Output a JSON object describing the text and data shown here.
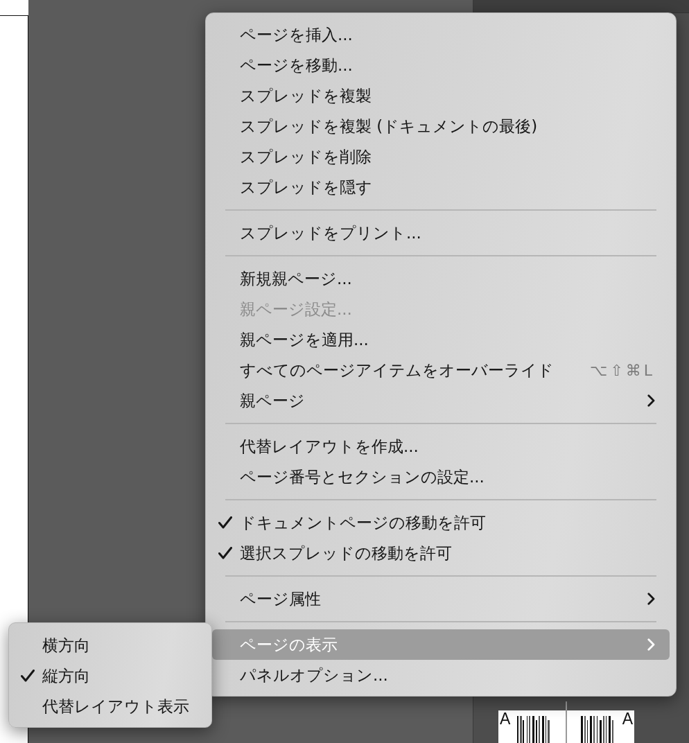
{
  "context_menu": {
    "sections": [
      {
        "items": [
          {
            "label": "ページを挿入...",
            "checked": false,
            "disabled": false,
            "selected": false,
            "has_submenu": false
          },
          {
            "label": "ページを移動...",
            "checked": false,
            "disabled": false,
            "selected": false,
            "has_submenu": false
          },
          {
            "label": "スプレッドを複製",
            "checked": false,
            "disabled": false,
            "selected": false,
            "has_submenu": false
          },
          {
            "label": "スプレッドを複製 (ドキュメントの最後)",
            "checked": false,
            "disabled": false,
            "selected": false,
            "has_submenu": false
          },
          {
            "label": "スプレッドを削除",
            "checked": false,
            "disabled": false,
            "selected": false,
            "has_submenu": false
          },
          {
            "label": "スプレッドを隠す",
            "checked": false,
            "disabled": false,
            "selected": false,
            "has_submenu": false
          }
        ]
      },
      {
        "items": [
          {
            "label": "スプレッドをプリント...",
            "checked": false,
            "disabled": false,
            "selected": false,
            "has_submenu": false
          }
        ]
      },
      {
        "items": [
          {
            "label": "新規親ページ...",
            "checked": false,
            "disabled": false,
            "selected": false,
            "has_submenu": false
          },
          {
            "label": "親ページ設定...",
            "checked": false,
            "disabled": true,
            "selected": false,
            "has_submenu": false
          },
          {
            "label": "親ページを適用...",
            "checked": false,
            "disabled": false,
            "selected": false,
            "has_submenu": false
          },
          {
            "label": "すべてのページアイテムをオーバーライド",
            "shortcut": "⌥⇧⌘L",
            "checked": false,
            "disabled": false,
            "selected": false,
            "has_submenu": false
          },
          {
            "label": "親ページ",
            "checked": false,
            "disabled": false,
            "selected": false,
            "has_submenu": true
          }
        ]
      },
      {
        "items": [
          {
            "label": "代替レイアウトを作成...",
            "checked": false,
            "disabled": false,
            "selected": false,
            "has_submenu": false
          },
          {
            "label": "ページ番号とセクションの設定...",
            "checked": false,
            "disabled": false,
            "selected": false,
            "has_submenu": false
          }
        ]
      },
      {
        "items": [
          {
            "label": "ドキュメントページの移動を許可",
            "checked": true,
            "disabled": false,
            "selected": false,
            "has_submenu": false
          },
          {
            "label": "選択スプレッドの移動を許可",
            "checked": true,
            "disabled": false,
            "selected": false,
            "has_submenu": false
          }
        ]
      },
      {
        "items": [
          {
            "label": "ページ属性",
            "checked": false,
            "disabled": false,
            "selected": false,
            "has_submenu": true
          }
        ]
      },
      {
        "items": [
          {
            "label": "ページの表示",
            "checked": false,
            "disabled": false,
            "selected": true,
            "has_submenu": true
          },
          {
            "label": "パネルオプション...",
            "checked": false,
            "disabled": false,
            "selected": false,
            "has_submenu": false
          }
        ]
      }
    ]
  },
  "page_view_submenu": {
    "items": [
      {
        "label": "横方向",
        "checked": false,
        "selected": false
      },
      {
        "label": "縦方向",
        "checked": true,
        "selected": false
      },
      {
        "label": "代替レイアウト表示",
        "checked": false,
        "selected": false
      }
    ]
  },
  "pages_panel": {
    "pages": [
      {
        "label": "A"
      },
      {
        "label": "A"
      }
    ]
  }
}
